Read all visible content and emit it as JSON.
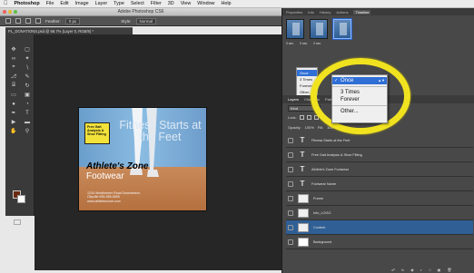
{
  "menubar": {
    "app": "Photoshop",
    "items": [
      "File",
      "Edit",
      "Image",
      "Layer",
      "Type",
      "Select",
      "Filter",
      "3D",
      "View",
      "Window",
      "Help"
    ]
  },
  "window": {
    "title": "Adobe Photoshop CS6"
  },
  "options": {
    "feather_label": "Feather:",
    "feather_value": "0 px",
    "style_label": "Style:",
    "style_value": "Normal"
  },
  "document": {
    "tab": "PL_DONATIONS.psd @ 66.7% (Layer 0, RGB/8) *",
    "headline": "Fitness Starts at the Feet",
    "badge": "Free Gait Analysis & Shoe Fitting",
    "brand_line1": "Athlete's Zone",
    "brand_line2": "Footwear",
    "address": "1234 Westheimer Road Somewhere, Cityville 555-555-5555 www.athleteszone.com"
  },
  "timeline": {
    "panel_tabs": [
      "Properties",
      "Info",
      "History",
      "Actions",
      "Timeline"
    ],
    "active_tab": "Timeline",
    "frames": [
      {
        "label": "1",
        "delay": "0 sec."
      },
      {
        "label": "2",
        "delay": "0 sec."
      },
      {
        "label": "3",
        "delay": "0 sec."
      }
    ],
    "loop_value": "Once",
    "small_menu": [
      "Once",
      "3 Times",
      "Forever",
      "Other..."
    ]
  },
  "loop_popup": {
    "options": [
      "Once",
      "3 Times",
      "Forever",
      "Other..."
    ],
    "selected": "Once"
  },
  "layers_panel": {
    "tabs": [
      "Layers",
      "Channels",
      "Paths"
    ],
    "active_tab": "Layers",
    "filter_label": "Kind",
    "lock_label": "Lock:",
    "opacity_label": "Opacity:",
    "opacity_value": "100%",
    "fill_label": "Fill:",
    "fill_value": "100%",
    "layers": [
      {
        "name": "Fitness Starts at the Feet",
        "type": "text",
        "selected": false
      },
      {
        "name": "Free Gait Analysis & Shoe Fitting",
        "type": "text",
        "selected": false
      },
      {
        "name": "Athlete's Zone Footwear",
        "type": "text",
        "selected": false
      },
      {
        "name": "Footwear Name",
        "type": "text",
        "selected": false
      },
      {
        "name": "Frame",
        "type": "image",
        "selected": false
      },
      {
        "name": "Info_LOGO",
        "type": "image",
        "selected": false
      },
      {
        "name": "Content",
        "type": "image",
        "selected": true
      },
      {
        "name": "Background",
        "type": "image",
        "selected": false
      }
    ]
  }
}
